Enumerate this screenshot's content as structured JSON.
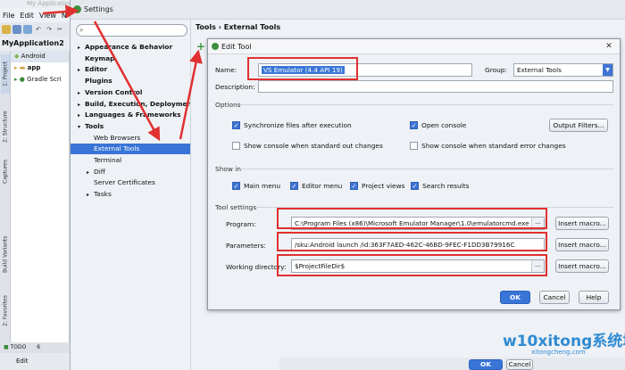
{
  "ide": {
    "title": "My Application",
    "menu": [
      "File",
      "Edit",
      "View",
      "N"
    ],
    "project_name": "MyApplication2",
    "tree": [
      {
        "label": "Android"
      },
      {
        "label": "app"
      },
      {
        "label": "Gradle Scri"
      }
    ],
    "side_tabs": [
      "1: Project",
      "2: Structure",
      "Captures",
      "Build Variants",
      "2: Favorites"
    ],
    "bottom_tools": "TODO",
    "status": "Edit",
    "bottom_extra": "6"
  },
  "settings": {
    "title": "Settings",
    "search_value": "",
    "tree": [
      {
        "label": "Appearance & Behavior",
        "level": 0,
        "bold": true,
        "arrow": "▸"
      },
      {
        "label": "Keymap",
        "level": 0,
        "bold": true,
        "arrow": ""
      },
      {
        "label": "Editor",
        "level": 0,
        "bold": true,
        "arrow": "▸"
      },
      {
        "label": "Plugins",
        "level": 0,
        "bold": true,
        "arrow": ""
      },
      {
        "label": "Version Control",
        "level": 0,
        "bold": true,
        "arrow": "▸"
      },
      {
        "label": "Build, Execution, Deployment",
        "level": 0,
        "bold": true,
        "arrow": "▸"
      },
      {
        "label": "Languages & Frameworks",
        "level": 0,
        "bold": true,
        "arrow": "▸"
      },
      {
        "label": "Tools",
        "level": 0,
        "bold": true,
        "arrow": "▾"
      },
      {
        "label": "Web Browsers",
        "level": 1,
        "bold": false,
        "arrow": ""
      },
      {
        "label": "External Tools",
        "level": 1,
        "bold": false,
        "arrow": "",
        "selected": true
      },
      {
        "label": "Terminal",
        "level": 1,
        "bold": false,
        "arrow": ""
      },
      {
        "label": "Diff",
        "level": 1,
        "bold": false,
        "arrow": "▸"
      },
      {
        "label": "Server Certificates",
        "level": 1,
        "bold": false,
        "arrow": ""
      },
      {
        "label": "Tasks",
        "level": 1,
        "bold": false,
        "arrow": "▸"
      }
    ],
    "breadcrumb": "Tools › External Tools",
    "ok_label": "OK"
  },
  "dialog": {
    "title": "Edit Tool",
    "name_label": "Name:",
    "name_value": "VS Emulator (4.4 API 19)",
    "group_label": "Group:",
    "group_value": "External Tools",
    "description_label": "Description:",
    "description_value": "",
    "options_section": "Options",
    "options": [
      {
        "label": "Synchronize files after execution",
        "checked": true
      },
      {
        "label": "Open console",
        "checked": true
      },
      {
        "label": "Show console when standard out changes",
        "checked": false
      },
      {
        "label": "Show console when standard error changes",
        "checked": false
      }
    ],
    "output_filters_label": "Output Filters...",
    "show_in_section": "Show in",
    "show_in": [
      {
        "label": "Main menu",
        "checked": true
      },
      {
        "label": "Editor menu",
        "checked": true
      },
      {
        "label": "Project views",
        "checked": true
      },
      {
        "label": "Search results",
        "checked": true
      }
    ],
    "tool_settings_section": "Tool settings",
    "program_label": "Program:",
    "program_value": "C:\\Program Files (x86)\\Microsoft Emulator Manager\\1.0\\emulatorcmd.exe",
    "parameters_label": "Parameters:",
    "parameters_value": "/sku:Android launch /id:363F7AED-462C-46BD-9FEC-F1DD3B79916C",
    "working_dir_label": "Working directory:",
    "working_dir_value": "$ProjectFileDir$",
    "insert_macro_label": "Insert macro...",
    "ok_label": "OK",
    "cancel_label": "Cancel",
    "help_label": "Help",
    "close_glyph": "✕",
    "dots": "..."
  },
  "watermark": {
    "brand": "w10xitong系统城",
    "url": "xitongcheng.com"
  },
  "colors": {
    "accent": "#3875d7",
    "highlight": "#e03030"
  }
}
